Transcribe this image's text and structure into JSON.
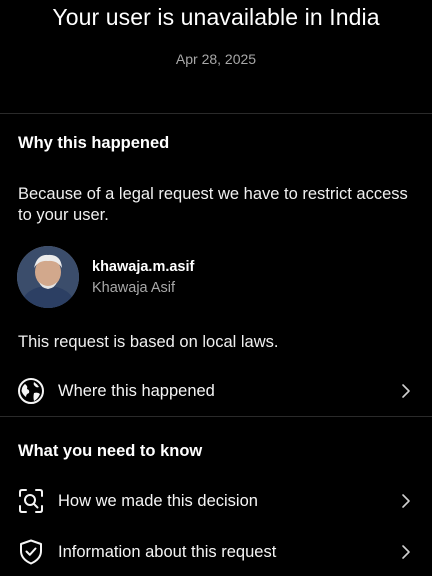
{
  "header": {
    "title": "Your user is unavailable in India",
    "date": "Apr 28, 2025"
  },
  "why": {
    "heading": "Why this happened",
    "description": "Because of a legal request we have to restrict access to your user.",
    "account": {
      "username": "khawaja.m.asif",
      "full_name": "Khawaja Asif"
    },
    "basis": "This request is based on local laws.",
    "where_label": "Where this happened",
    "where_icon": "globe-icon"
  },
  "know": {
    "heading": "What you need to know",
    "items": [
      {
        "label": "How we made this decision",
        "icon": "search-magnifier-icon"
      },
      {
        "label": "Information about this request",
        "icon": "shield-check-icon"
      }
    ]
  },
  "colors": {
    "background": "#000000",
    "text": "#f5f5f5",
    "muted": "#a8a8a8",
    "divider": "#2a2a2a"
  }
}
